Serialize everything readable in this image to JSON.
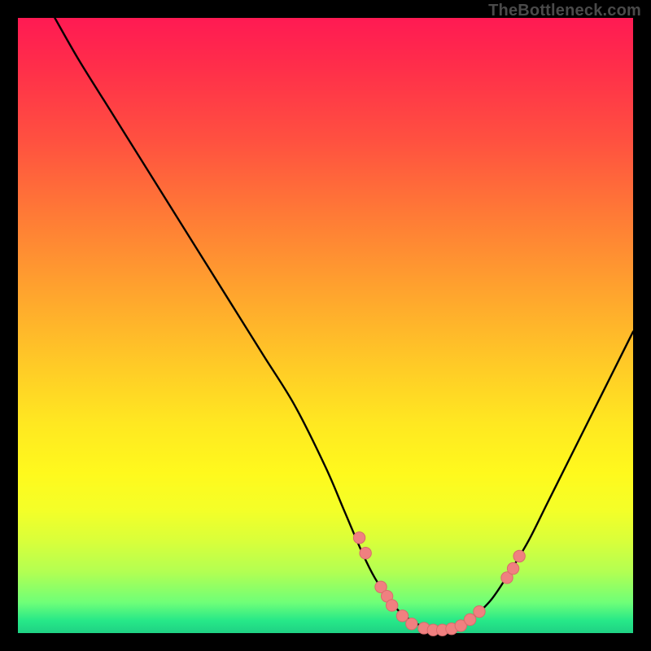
{
  "watermark": "TheBottleneck.com",
  "colors": {
    "curve": "#000000",
    "dot_fill": "#f08080",
    "dot_stroke": "#d96b6b",
    "background_black": "#000000"
  },
  "chart_data": {
    "type": "line",
    "title": "",
    "xlabel": "",
    "ylabel": "",
    "xlim": [
      0,
      100
    ],
    "ylim": [
      0,
      100
    ],
    "grid": false,
    "legend": false,
    "series": [
      {
        "name": "bottleneck-curve",
        "x": [
          6,
          10,
          15,
          20,
          25,
          30,
          35,
          40,
          45,
          50,
          53,
          56,
          58,
          60,
          62,
          64,
          66,
          68,
          70,
          72,
          74,
          77,
          80,
          83,
          86,
          89,
          92,
          95,
          98,
          100
        ],
        "y": [
          100,
          93,
          85,
          77,
          69,
          61,
          53,
          45,
          37,
          27,
          20,
          13,
          9,
          6,
          3.5,
          2,
          1,
          0.5,
          0.5,
          1,
          2.5,
          5.5,
          10,
          15,
          21,
          27,
          33,
          39,
          45,
          49
        ]
      }
    ],
    "scatter_points": [
      {
        "x": 55.5,
        "y": 15.5
      },
      {
        "x": 56.5,
        "y": 13.0
      },
      {
        "x": 59.0,
        "y": 7.5
      },
      {
        "x": 60.0,
        "y": 6.0
      },
      {
        "x": 60.8,
        "y": 4.5
      },
      {
        "x": 62.5,
        "y": 2.8
      },
      {
        "x": 64.0,
        "y": 1.5
      },
      {
        "x": 66.0,
        "y": 0.8
      },
      {
        "x": 67.5,
        "y": 0.5
      },
      {
        "x": 69.0,
        "y": 0.5
      },
      {
        "x": 70.5,
        "y": 0.7
      },
      {
        "x": 72.0,
        "y": 1.2
      },
      {
        "x": 73.5,
        "y": 2.2
      },
      {
        "x": 75.0,
        "y": 3.5
      },
      {
        "x": 79.5,
        "y": 9.0
      },
      {
        "x": 80.5,
        "y": 10.5
      },
      {
        "x": 81.5,
        "y": 12.5
      }
    ]
  }
}
